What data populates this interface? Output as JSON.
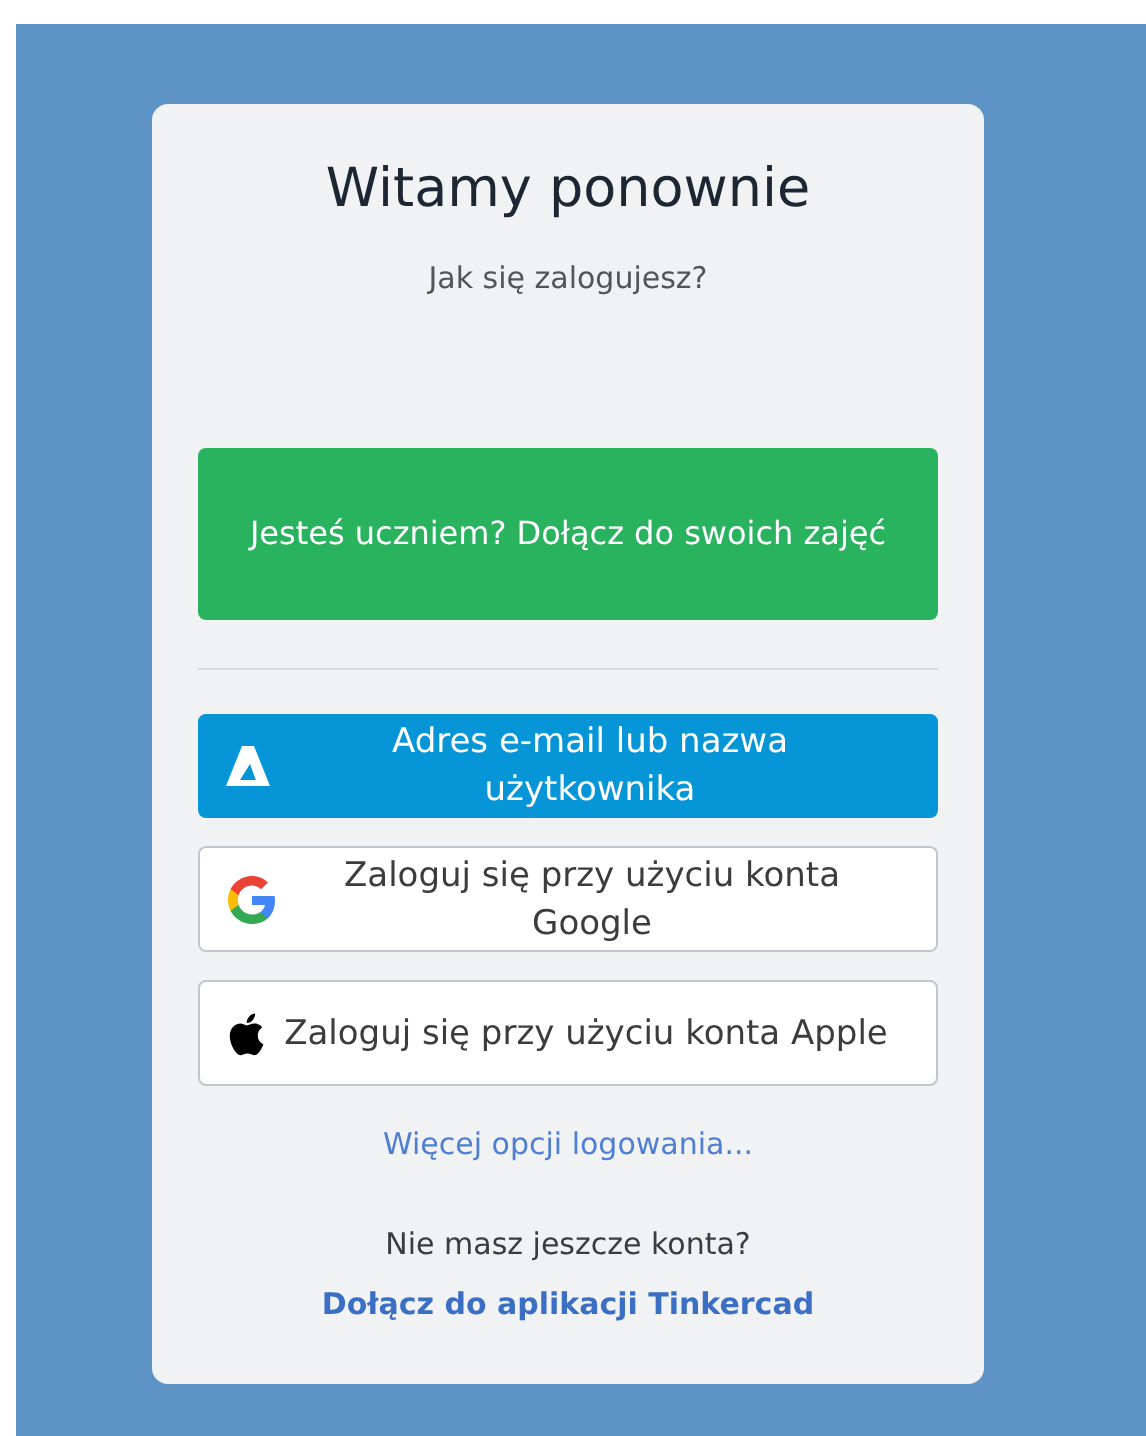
{
  "title": "Witamy ponownie",
  "subtitle": "Jak się zalogujesz?",
  "student_button": "Jesteś uczniem? Dołącz do swoich zajęć",
  "login_options": [
    {
      "kind": "autodesk",
      "label": "Adres e-mail lub nazwa użytkownika"
    },
    {
      "kind": "google",
      "label": "Zaloguj się przy użyciu konta Google"
    },
    {
      "kind": "apple",
      "label": "Zaloguj się przy użyciu konta Apple"
    }
  ],
  "more_options_link": "Więcej opcji logowania...",
  "no_account_text": "Nie masz jeszcze konta?",
  "join_link": "Dołącz do aplikacji Tinkercad"
}
